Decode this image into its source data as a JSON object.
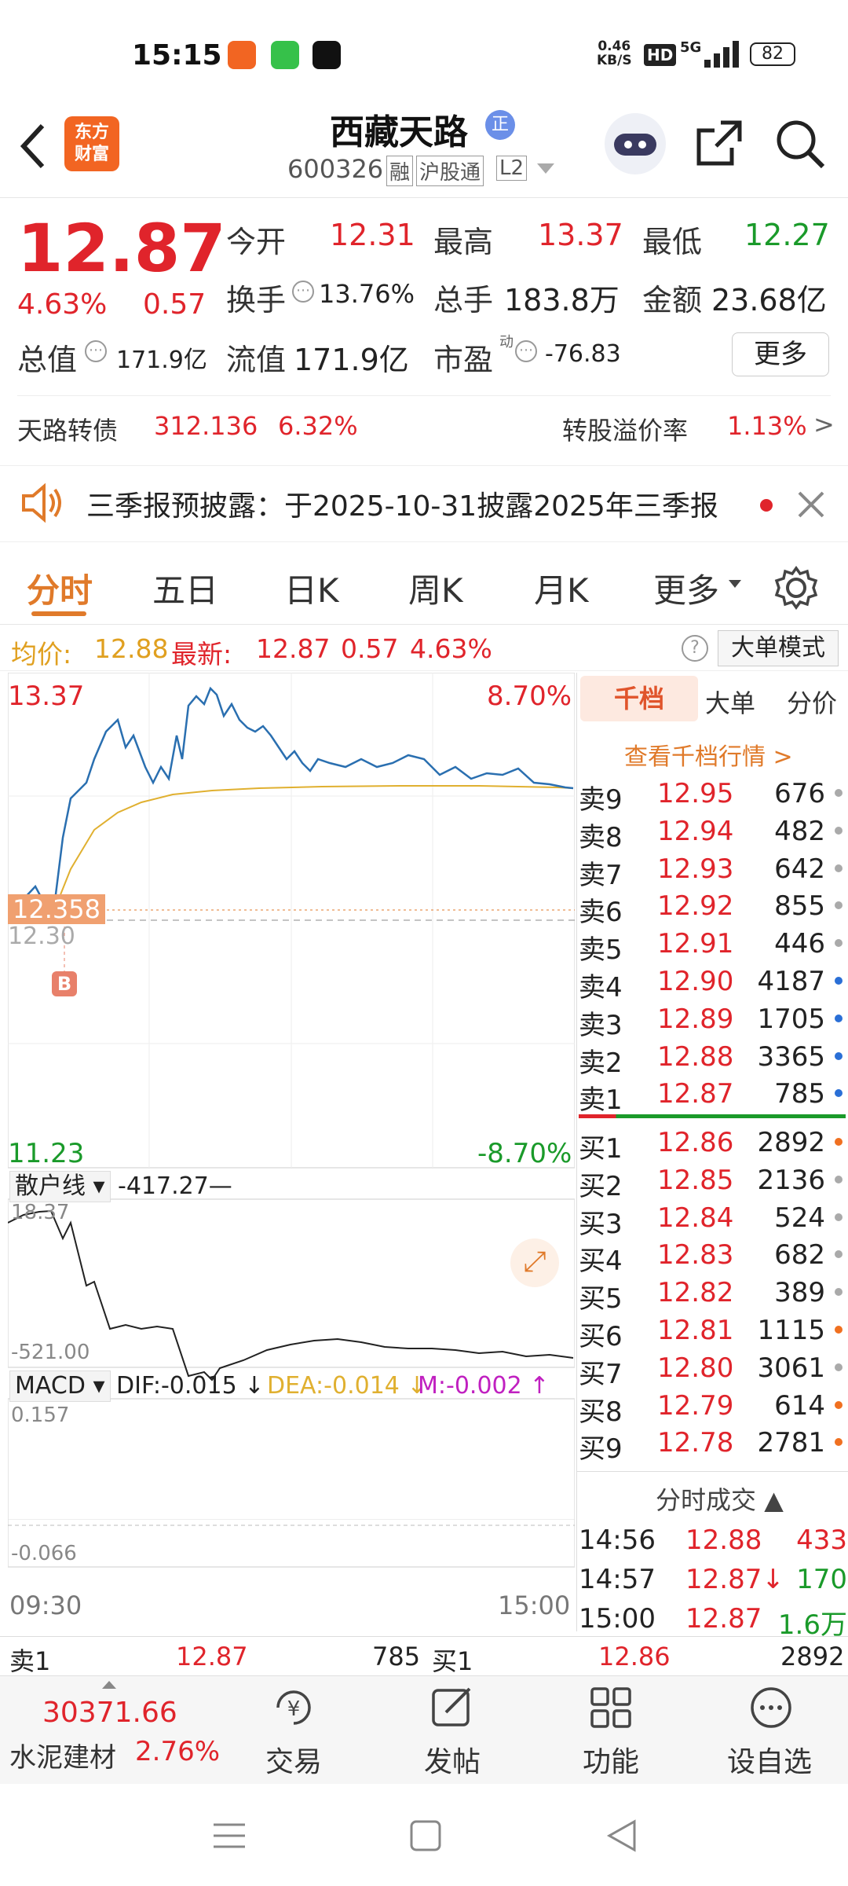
{
  "status": {
    "time": "15:15",
    "net_speed": "0.46",
    "net_unit": "KB/S",
    "hd": "HD",
    "signal": "5G",
    "battery": "82"
  },
  "nav": {
    "title": "西藏天路",
    "code": "600326",
    "badges": [
      "融",
      "沪股通",
      "L2"
    ],
    "logo_line1": "东方",
    "logo_line2": "财富",
    "cert": "正"
  },
  "quote": {
    "price": "12.87",
    "pct": "4.63%",
    "chg": "0.57",
    "labels": {
      "open": "今开",
      "high": "最高",
      "low": "最低",
      "turnover": "换手",
      "volume": "总手",
      "amount": "金额",
      "mktcap": "总值",
      "float": "流值",
      "pe": "市盈",
      "more": "更多"
    },
    "values": {
      "open": "12.31",
      "high": "13.37",
      "low": "12.27",
      "turnover": "13.76%",
      "volume": "183.8万",
      "amount": "23.68亿",
      "mktcap": "171.9亿",
      "float": "171.9亿",
      "pe": "-76.83"
    },
    "pe_sup": "动",
    "bond_name": "天路转债",
    "bond_price": "312.136",
    "bond_pct": "6.32%",
    "premium_label": "转股溢价率",
    "premium_val": "1.13%"
  },
  "notice": {
    "text": "三季报预披露：于2025-10-31披露2025年三季报"
  },
  "tabs": [
    "分时",
    "五日",
    "日K",
    "周K",
    "月K",
    "更多"
  ],
  "info": {
    "avg_label": "均价:",
    "avg": "12.88",
    "latest_label": "最新:",
    "latest": "12.87",
    "chg": "0.57",
    "pct": "4.63%",
    "mode": "大单模式"
  },
  "chart": {
    "max": "13.37",
    "max_pct": "8.70%",
    "min": "11.23",
    "min_pct": "-8.70%",
    "marker": "12.358",
    "marker2": "12.30",
    "buy_mark": "B",
    "indicator": "散户线",
    "indicator_val": "-417.27",
    "ind_top": "18.37",
    "ind_bot": "-521.00",
    "macd": "MACD",
    "dif": "DIF:-0.015",
    "dea": "DEA:-0.014",
    "m": "M:-0.002",
    "macd_top": "0.157",
    "macd_bot": "-0.066",
    "t_start": "09:30",
    "t_end": "15:00"
  },
  "book": {
    "tabs": [
      "千档",
      "大单",
      "分价"
    ],
    "link": "查看千档行情 >",
    "asks": [
      {
        "l": "卖9",
        "p": "12.95",
        "v": "676"
      },
      {
        "l": "卖8",
        "p": "12.94",
        "v": "482"
      },
      {
        "l": "卖7",
        "p": "12.93",
        "v": "642"
      },
      {
        "l": "卖6",
        "p": "12.92",
        "v": "855"
      },
      {
        "l": "卖5",
        "p": "12.91",
        "v": "446"
      },
      {
        "l": "卖4",
        "p": "12.90",
        "v": "4187"
      },
      {
        "l": "卖3",
        "p": "12.89",
        "v": "1705"
      },
      {
        "l": "卖2",
        "p": "12.88",
        "v": "3365"
      },
      {
        "l": "卖1",
        "p": "12.87",
        "v": "785"
      }
    ],
    "bids": [
      {
        "l": "买1",
        "p": "12.86",
        "v": "2892"
      },
      {
        "l": "买2",
        "p": "12.85",
        "v": "2136"
      },
      {
        "l": "买3",
        "p": "12.84",
        "v": "524"
      },
      {
        "l": "买4",
        "p": "12.83",
        "v": "682"
      },
      {
        "l": "买5",
        "p": "12.82",
        "v": "389"
      },
      {
        "l": "买6",
        "p": "12.81",
        "v": "1115"
      },
      {
        "l": "买7",
        "p": "12.80",
        "v": "3061"
      },
      {
        "l": "买8",
        "p": "12.79",
        "v": "614"
      },
      {
        "l": "买9",
        "p": "12.78",
        "v": "2781"
      }
    ],
    "trades_title": "分时成交",
    "trades": [
      {
        "t": "14:56",
        "p": "12.88",
        "v": "433"
      },
      {
        "t": "14:57",
        "p": "12.87↓",
        "v": "170"
      },
      {
        "t": "15:00",
        "p": "12.87",
        "v": "1.6万"
      }
    ]
  },
  "strip": {
    "ask_label": "卖1",
    "ask_price": "12.87",
    "ask_vol": "785",
    "bid_label": "买1",
    "bid_price": "12.86",
    "bid_vol": "2892"
  },
  "bottom": {
    "index_val": "30371.66",
    "index_name": "水泥建材",
    "index_pct": "2.76%",
    "trade": "交易",
    "post": "发帖",
    "func": "功能",
    "watch": "设自选"
  }
}
